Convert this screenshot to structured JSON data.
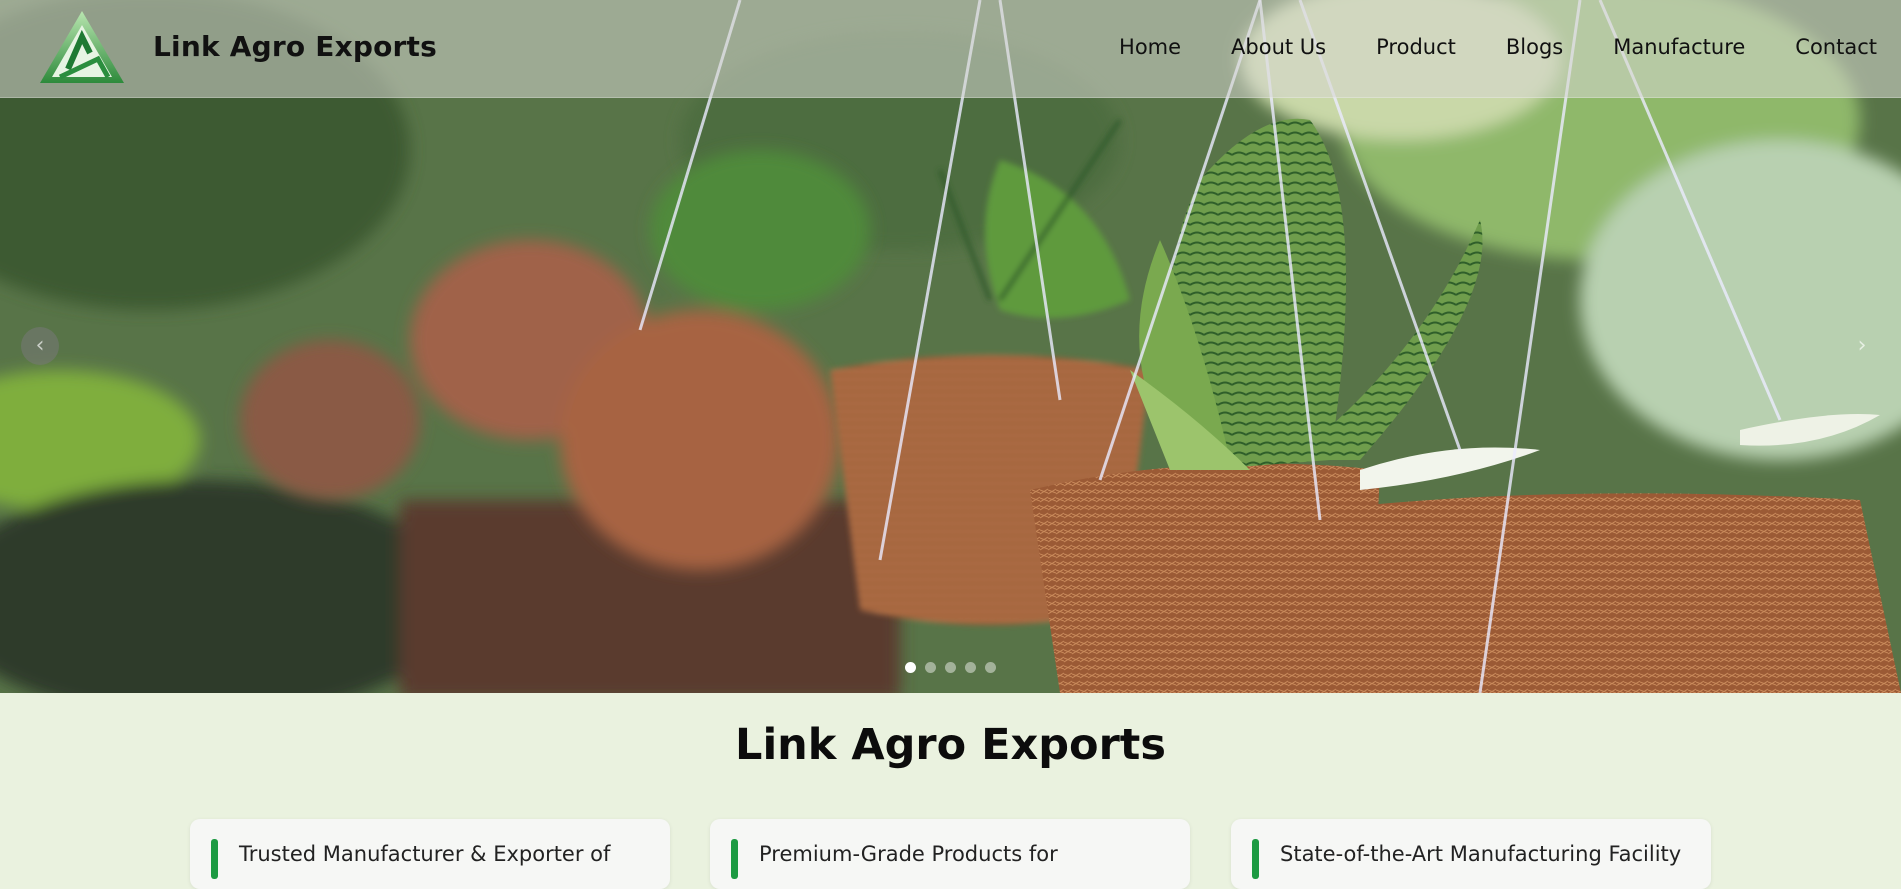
{
  "brand": {
    "name": "Link Agro Exports",
    "logo": "triangle-la-logo"
  },
  "nav": {
    "items": [
      "Home",
      "About Us",
      "Product",
      "Blogs",
      "Manufacture",
      "Contact"
    ]
  },
  "carousel": {
    "prev_icon": "chevron-left-icon",
    "next_icon": "chevron-right-icon",
    "prev_glyph": "‹",
    "next_glyph": "›",
    "slides": 5,
    "active_slide": 1
  },
  "section": {
    "title": "Link Agro Exports"
  },
  "cards": [
    {
      "text": "Trusted Manufacturer & Exporter of"
    },
    {
      "text": "Premium-Grade Products for"
    },
    {
      "text": "State-of-the-Art Manufacturing Facility"
    }
  ],
  "colors": {
    "accent_green": "#1d9a42",
    "page_background": "#eaf2df"
  }
}
